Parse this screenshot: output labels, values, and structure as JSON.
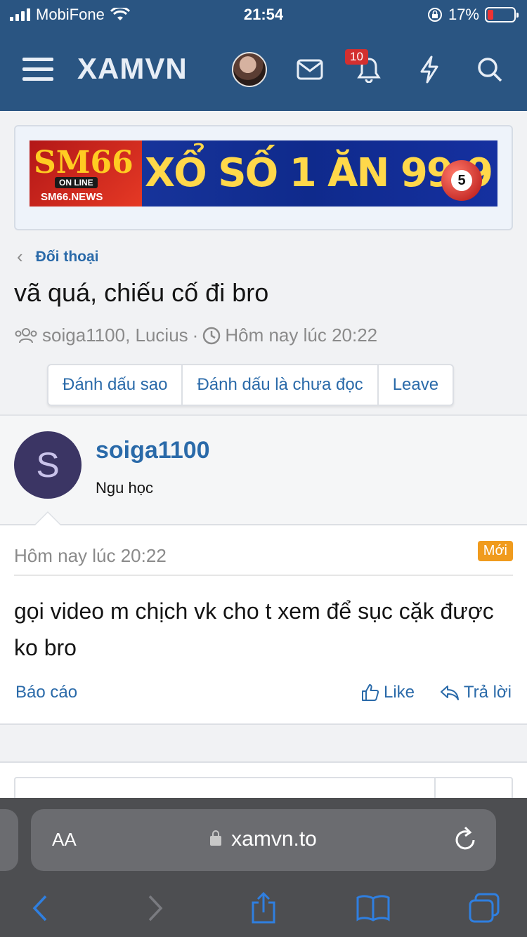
{
  "status_bar": {
    "carrier": "MobiFone",
    "time": "21:54",
    "battery": "17%"
  },
  "header": {
    "logo": "XAMVN",
    "notification_count": "10"
  },
  "ad": {
    "brand": "SM66",
    "brand_sub": "ON LINE",
    "brand_site": "SM66.NEWS",
    "tagline": "XỔ SỐ 1 ĂN 99.9",
    "ball_number": "5"
  },
  "breadcrumb": {
    "label": "Đối thoại"
  },
  "thread": {
    "title": "vã quá, chiếu cố đi bro",
    "participants": "soiga1100, Lucius",
    "separator": "·",
    "date": "Hôm nay lúc 20:22",
    "buttons": [
      "Đánh dấu sao",
      "Đánh dấu là chưa đọc",
      "Leave"
    ]
  },
  "message": {
    "avatar_letter": "S",
    "username": "soiga1100",
    "user_title": "Ngu học",
    "time": "Hôm nay lúc 20:22",
    "new_badge": "Mới",
    "body": "gọi video m chịch vk cho t xem để sục cặk được ko bro",
    "report": "Báo cáo",
    "like": "Like",
    "reply": "Trả lời"
  },
  "browser": {
    "aa_label": "AA",
    "url": "xamvn.to"
  },
  "colors": {
    "header_bg": "#2a5582",
    "link": "#2a6aa9",
    "new_badge": "#f09b1d",
    "safari_bar": "#4d4e51"
  }
}
